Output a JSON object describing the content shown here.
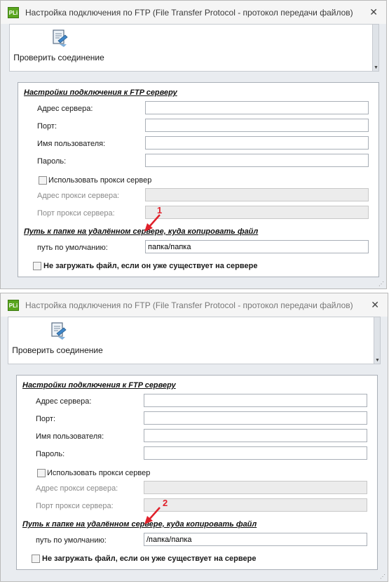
{
  "windows": [
    {
      "title": "Настройка подключения по FTP (File Transfer Protocol - протокол передачи файлов)",
      "app_icon_text": "PLi",
      "close_icon": "close-icon",
      "toolbar": {
        "check_connection_label": "Проверить соединение",
        "icon": "connection-check-icon"
      },
      "section_connection": "Настройки подключения к FTP серверу",
      "labels": {
        "server_address": "Адрес сервера:",
        "port": "Порт:",
        "username": "Имя пользователя:",
        "password": "Пароль:",
        "use_proxy": "Использовать прокси сервер",
        "proxy_address": "Адрес прокси сервера:",
        "proxy_port": "Порт прокси сервера:"
      },
      "values": {
        "server_address": "",
        "port": "",
        "username": "",
        "password": "",
        "proxy_address": "",
        "proxy_port": ""
      },
      "section_path": "Путь к папке на удалённом сервере, куда копировать файл",
      "default_path_label": "путь по умолчанию:",
      "default_path_value": "папка/папка",
      "skip_existing_label": "Не загружать файл, если он уже существует на сервере",
      "annotation_number": "1"
    },
    {
      "title": "Настройка подключения по FTP (File Transfer Protocol - протокол передачи файлов)",
      "app_icon_text": "PLi",
      "close_icon": "close-icon",
      "toolbar": {
        "check_connection_label": "Проверить соединение",
        "icon": "connection-check-icon"
      },
      "section_connection": "Настройки подключения к FTP серверу",
      "labels": {
        "server_address": "Адрес сервера:",
        "port": "Порт:",
        "username": "Имя пользователя:",
        "password": "Пароль:",
        "use_proxy": "Использовать прокси сервер",
        "proxy_address": "Адрес прокси сервера:",
        "proxy_port": "Порт прокси сервера:"
      },
      "values": {
        "server_address": "",
        "port": "",
        "username": "",
        "password": "",
        "proxy_address": "",
        "proxy_port": ""
      },
      "section_path": "Путь к папке на удалённом сервере, куда копировать файл",
      "default_path_label": "путь по умолчанию:",
      "default_path_value": "/папка/папка",
      "skip_existing_label": "Не загружать файл, если он уже существует на сервере",
      "annotation_number": "2"
    }
  ],
  "colors": {
    "annotation": "#e0202a",
    "app_icon": "#5aa61e",
    "panel_bg": "#e9ecf0"
  }
}
